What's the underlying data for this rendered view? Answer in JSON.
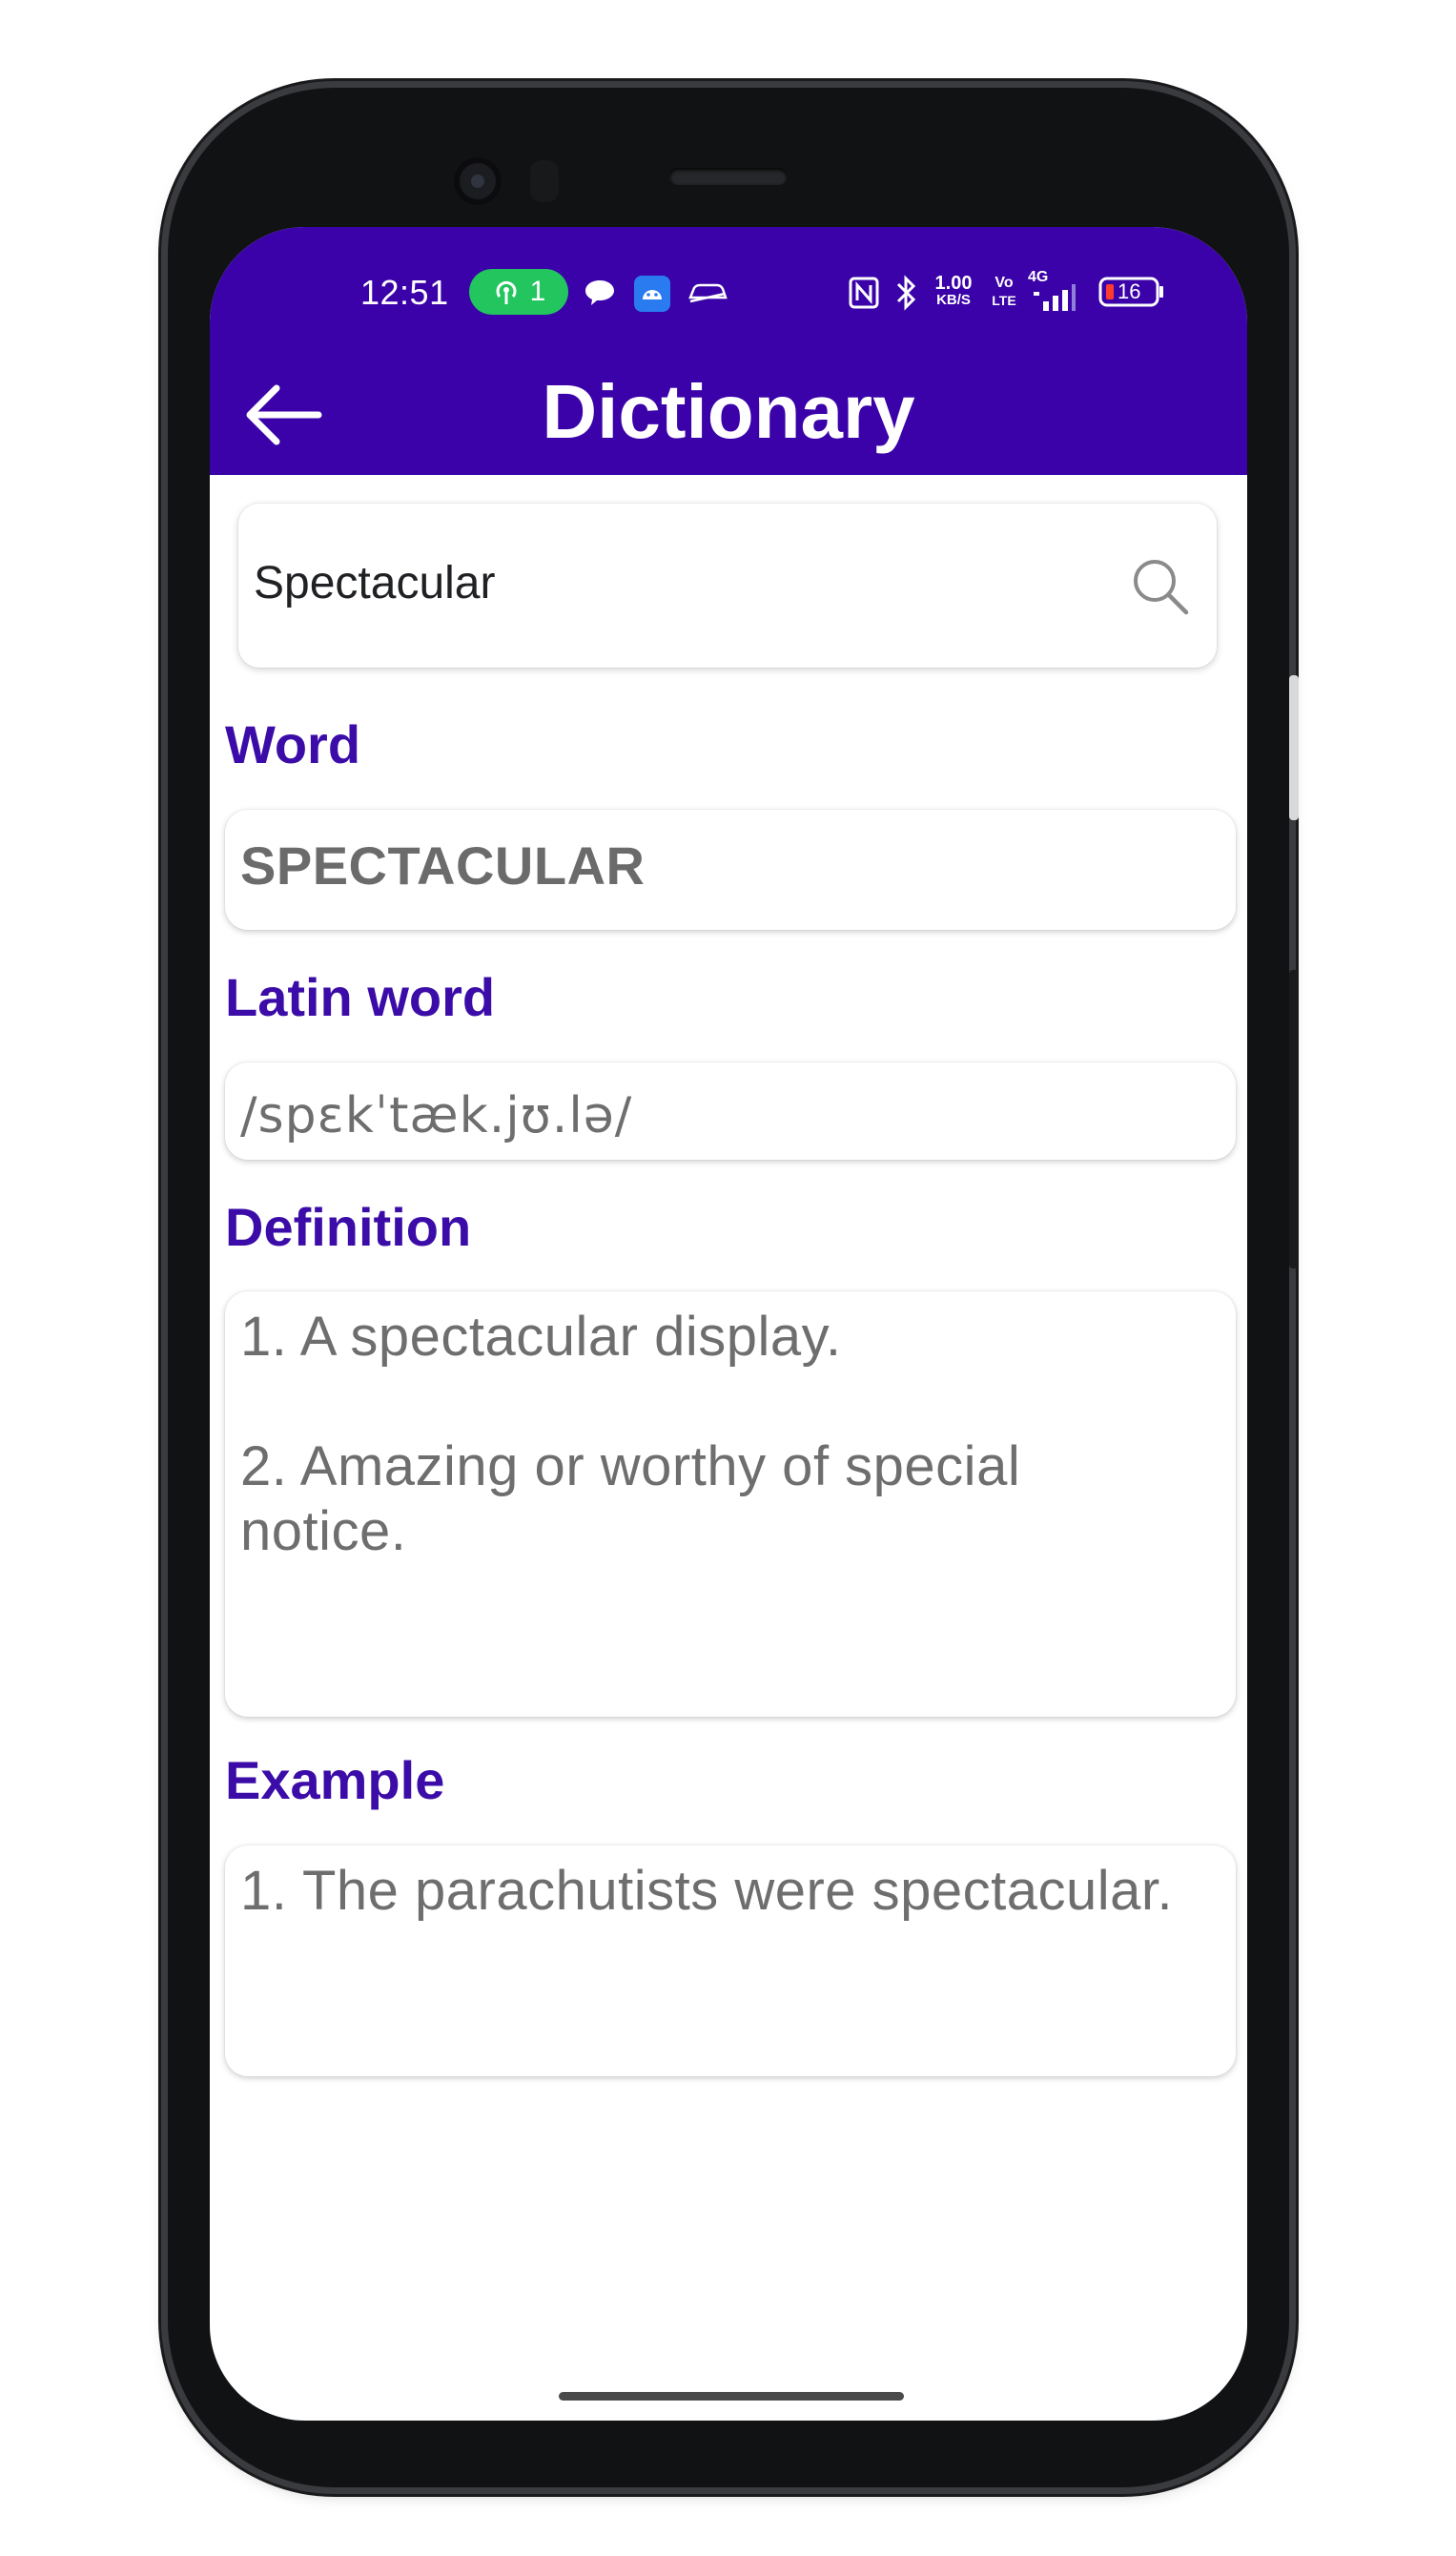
{
  "status_bar": {
    "time": "12:51",
    "hotspot_count": "1",
    "data_rate_value": "1.00",
    "data_rate_unit": "KB/S",
    "volte_top": "Vo",
    "volte_bottom": "LTE",
    "network": "4G",
    "battery": "16",
    "icons": [
      "hotspot-icon",
      "chat-bubble-icon",
      "android-app-icon",
      "car-icon",
      "nfc-icon",
      "bluetooth-icon",
      "signal-icon",
      "battery-icon"
    ]
  },
  "header": {
    "title": "Dictionary",
    "back_icon": "arrow-left-icon"
  },
  "search": {
    "value": "Spectacular",
    "icon": "search-icon"
  },
  "sections": {
    "word_label": "Word",
    "word_value": "SPECTACULAR",
    "latin_label": "Latin word",
    "latin_value": "/spɛkˈtæk.jʊ.lə/",
    "definition_label": "Definition",
    "definition_1": "1. A spectacular display.",
    "definition_2a": "2. Amazing or worthy of special",
    "definition_2b": "notice.",
    "example_label": "Example",
    "example_1": "1. The parachutists were spectacular."
  },
  "colors": {
    "primary": "#3a02a8",
    "label": "#3b0ca8",
    "text_muted": "#6e6e6e",
    "hotspot": "#22c55e"
  }
}
